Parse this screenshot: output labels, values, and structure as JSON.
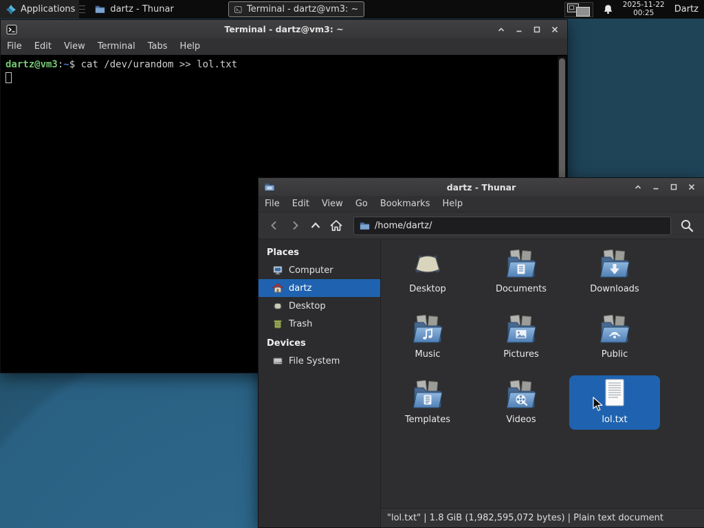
{
  "panel": {
    "applications_label": "Applications",
    "tasks": [
      {
        "title": "dartz - Thunar"
      },
      {
        "title": "Terminal - dartz@vm3: ~"
      }
    ],
    "clock_date": "2025-11-22",
    "clock_time": "00:25",
    "user_label": "Dartz"
  },
  "terminal": {
    "title": "Terminal - dartz@vm3: ~",
    "menu": [
      "File",
      "Edit",
      "View",
      "Terminal",
      "Tabs",
      "Help"
    ],
    "prompt_user": "dartz@vm3",
    "prompt_colon": ":",
    "prompt_path": "~",
    "prompt_sign": "$ ",
    "command": "cat /dev/urandom >> lol.txt"
  },
  "thunar": {
    "title": "dartz - Thunar",
    "menu": [
      "File",
      "Edit",
      "View",
      "Go",
      "Bookmarks",
      "Help"
    ],
    "path": "/home/dartz/",
    "sidebar": {
      "places_header": "Places",
      "places": [
        "Computer",
        "dartz",
        "Desktop",
        "Trash"
      ],
      "devices_header": "Devices",
      "devices": [
        "File System"
      ]
    },
    "files": [
      "Desktop",
      "Documents",
      "Downloads",
      "Music",
      "Pictures",
      "Public",
      "Templates",
      "Videos",
      "lol.txt"
    ],
    "selected_file": "lol.txt",
    "statusbar": "\"lol.txt\"  |  1.8 GiB (1,982,595,072 bytes)  |  Plain text document"
  },
  "colors": {
    "selection_blue": "#1f63b0",
    "terminal_prompt_green": "#72c872",
    "terminal_path_blue": "#4c7bbf",
    "wallpaper_teal": "#2a6183",
    "panel_black": "#0c0c0c",
    "window_gray": "#2e2e30"
  }
}
